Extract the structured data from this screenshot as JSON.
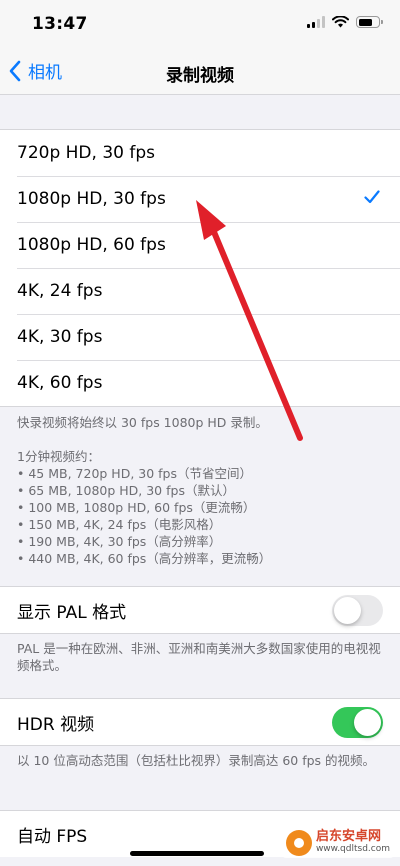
{
  "status_bar": {
    "time": "13:47"
  },
  "nav": {
    "back_label": "相机",
    "title": "录制视频"
  },
  "resolution_options": [
    {
      "label": "720p HD, 30 fps",
      "selected": false
    },
    {
      "label": "1080p HD, 30 fps",
      "selected": true
    },
    {
      "label": "1080p HD, 60 fps",
      "selected": false
    },
    {
      "label": "4K, 24 fps",
      "selected": false
    },
    {
      "label": "4K, 30 fps",
      "selected": false
    },
    {
      "label": "4K, 60 fps",
      "selected": false
    }
  ],
  "resolution_footer": {
    "note": "快录视频将始终以 30 fps 1080p HD 录制。",
    "size_heading": "1分钟视频约：",
    "size_list": [
      "• 45 MB, 720p HD, 30 fps（节省空间）",
      "• 65 MB, 1080p HD, 30 fps（默认）",
      "• 100 MB, 1080p HD, 60 fps（更流畅）",
      "• 150 MB, 4K, 24 fps（电影风格）",
      "• 190 MB, 4K, 30 fps（高分辨率）",
      "• 440 MB, 4K, 60 fps（高分辨率，更流畅）"
    ]
  },
  "pal": {
    "label": "显示 PAL 格式",
    "enabled": false,
    "footer": "PAL 是一种在欧洲、非洲、亚洲和南美洲大多数国家使用的电视视频格式。"
  },
  "hdr": {
    "label": "HDR 视频",
    "enabled": true,
    "footer": "以 10 位高动态范围（包括杜比视界）录制高达 60 fps 的视频。"
  },
  "auto_fps": {
    "label": "自动 FPS"
  },
  "watermark": {
    "name": "启东安卓网",
    "url": "www.qdltsd.com"
  },
  "colors": {
    "accent": "#0a7aff",
    "toggle_on": "#34c759",
    "annotation_arrow": "#e0202a"
  }
}
